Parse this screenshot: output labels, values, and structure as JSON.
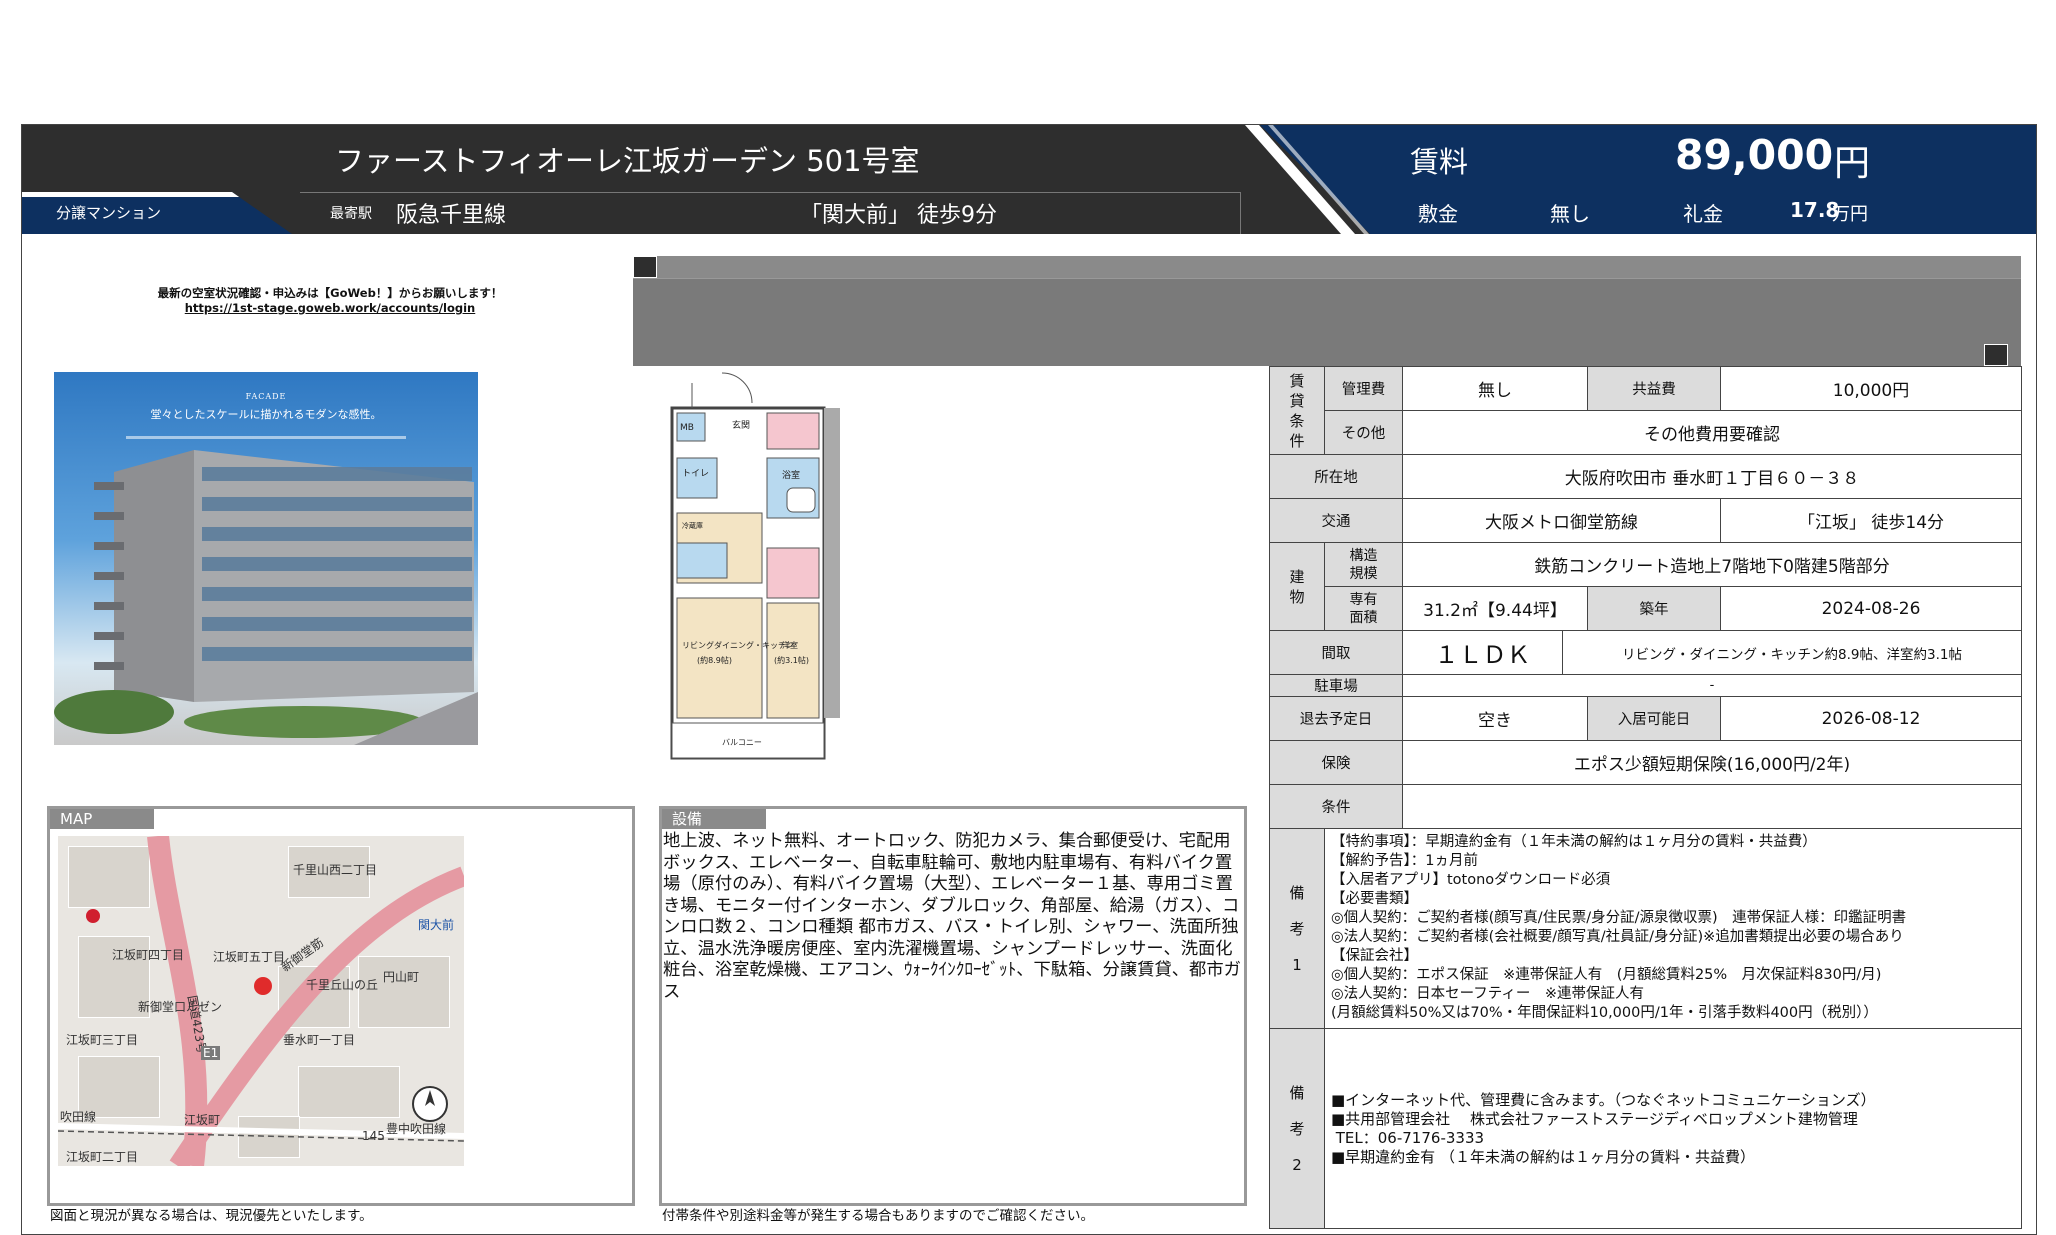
{
  "header": {
    "title": "ファーストフィオーレ江坂ガーデン 501号室",
    "type_badge": "分譲マンション",
    "station_label": "最寄駅",
    "line": "阪急千里線",
    "station_walk": "「関大前」 徒歩9分",
    "rent_label": "賃料",
    "rent_value": "89,000",
    "rent_unit": "円",
    "deposit_label": "敷金",
    "deposit_value": "無し",
    "key_money_label": "礼金",
    "key_money_value": "17.8",
    "key_money_unit": "万円"
  },
  "notice": {
    "line1": "最新の空室状況確認・申込みは【GoWeb！】からお願いします！",
    "line2": "https://1st-stage.goweb.work/accounts/login"
  },
  "exterior": {
    "facade_label": "FACADE",
    "facade_caption": "堂々としたスケールに描かれるモダンな感性。"
  },
  "floorplan": {
    "labels": [
      "MB",
      "玄関",
      "トイレ",
      "浴室",
      "冷蔵庫",
      "リビングダイニング・キッチン",
      "(約8.9帖)",
      "洋室",
      "(約3.1帖)",
      "バルコニー"
    ]
  },
  "table": {
    "rental_terms_label": "賃貸条件",
    "management_fee_label": "管理費",
    "management_fee": "無し",
    "common_fee_label": "共益費",
    "common_fee": "10,000円",
    "other_label": "その他",
    "other": "その他費用要確認",
    "address_label": "所在地",
    "address": "大阪府吹田市 垂水町１丁目６０－３８",
    "transport_label": "交通",
    "transport_line": "大阪メトロ御堂筋線",
    "transport_walk": "「江坂」 徒歩14分",
    "building_label": "建物",
    "structure_label": "構造規模",
    "structure": "鉄筋コンクリート造地上7階地下0階建5階部分",
    "area_label": "専有面積",
    "area": "31.2㎡【9.44坪】",
    "built_label": "築年",
    "built": "2024-08-26",
    "layout_label": "間取",
    "layout": "１ＬＤＫ",
    "layout_detail": "リビング・ダイニング・キッチン約8.9帖、洋室約3.1帖",
    "parking_label": "駐車場",
    "parking": "-",
    "move_out_label": "退去予定日",
    "move_out": "空き",
    "move_in_label": "入居可能日",
    "move_in": "2026-08-12",
    "insurance_label": "保険",
    "insurance": "エポス少額短期保険(16,000円/2年)",
    "conditions_label": "条件",
    "conditions": "",
    "remarks1_label": "備考1",
    "remarks1": [
      "【特約事項】：早期違約金有（１年未満の解約は１ヶ月分の賃料・共益費）",
      "【解約予告】：1ヵ月前",
      "【入居者アプリ】totonoダウンロード必須",
      "【必要書類】",
      "◎個人契約：ご契約者様(顔写真/住民票/身分証/源泉徴収票)　連帯保証人様：印鑑証明書",
      "◎法人契約：ご契約者様(会社概要/顔写真/社員証/身分証)※追加書類提出必要の場合あり",
      "【保証会社】",
      "◎個人契約：エポス保証　※連帯保証人有　(月額総賃料25%　月次保証料830円/月)",
      "◎法人契約：日本セーフティー　※連帯保証人有",
      "(月額総賃料50%又は70%・年間保証料10,000円/1年・引落手数料400円（税別））"
    ],
    "remarks2_label": "備考2",
    "remarks2": [
      "■インターネット代、管理費に含みます。（つなぐネットコミュニケーションズ）",
      "■共用部管理会社　 株式会社ファーストステージディベロップメント建物管理",
      " TEL：06-7176-3333",
      "■早期違約金有 （１年未満の解約は１ヶ月分の賃料・共益費）"
    ]
  },
  "map": {
    "title": "MAP",
    "footnote": "図面と現況が異なる場合は、現況優先といたします。",
    "labels": [
      "千里山西二丁目",
      "関大前",
      "江坂町四丁目",
      "江坂町五丁目",
      "国道423号",
      "新御堂筋",
      "千里丘山の丘",
      "円山町",
      "新御堂口ルゼン",
      "江坂町三丁目",
      "垂水町一丁目",
      "吹田線",
      "江坂町",
      "豊中吹田線",
      "江坂町二丁目",
      "E1",
      "145"
    ]
  },
  "facilities": {
    "title": "設備",
    "text": "地上波、ネット無料、オートロック、防犯カメラ、集合郵便受け、宅配用ボックス、エレベーター、自転車駐輪可、敷地内駐車場有、有料バイク置場（原付のみ）、有料バイク置場（大型）、エレベーター１基、専用ゴミ置き場、モニター付インターホン、ダブルロック、角部屋、給湯（ガス）、コンロ口数２、コンロ種類 都市ガス、バス・トイレ別、シャワー、洗面所独立、温水洗浄暖房便座、室内洗濯機置場、シャンプードレッサー、洗面化粧台、浴室乾燥機、エアコン、ｳｫｰｸｲﾝｸﾛｰｾﾞｯﾄ、下駄箱、分譲賃貸、都市ガス",
    "footnote": "付帯条件や別途料金等が発生する場合もありますのでご確認ください。"
  },
  "colors": {
    "navy": "#0d3060",
    "dark": "#2e2e2e",
    "label_bg": "#dcdcdc",
    "panel_gray": "#8a8a8a"
  }
}
